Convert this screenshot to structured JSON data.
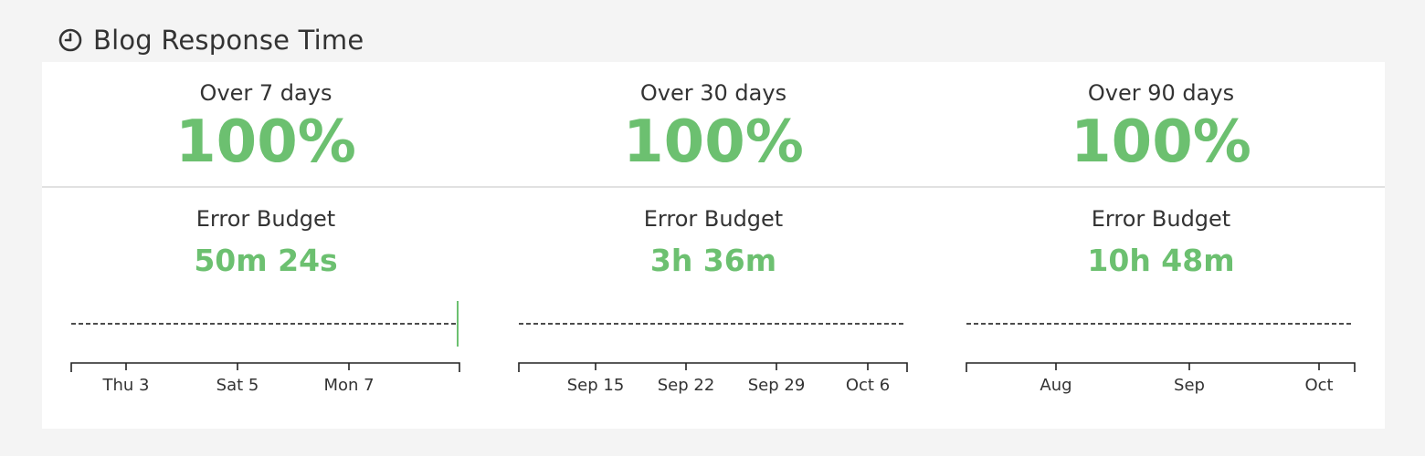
{
  "widget": {
    "title": "Blog Response Time",
    "icon": "clock-icon"
  },
  "colors": {
    "good": "#6cc070",
    "text": "#333333",
    "background": "#f4f4f4",
    "card": "#ffffff"
  },
  "periods": [
    {
      "label": "Over 7 days",
      "percent": "100%",
      "budget_label": "Error Budget",
      "budget_value": "50m 24s",
      "ticks": [
        {
          "label": "Thu 3",
          "pos": 62
        },
        {
          "label": "Sat 5",
          "pos": 184
        },
        {
          "label": "Mon 7",
          "pos": 306
        }
      ],
      "green_bar": true
    },
    {
      "label": "Over 30 days",
      "percent": "100%",
      "budget_label": "Error Budget",
      "budget_value": "3h 36m",
      "ticks": [
        {
          "label": "Sep 15",
          "pos": 86
        },
        {
          "label": "Sep 22",
          "pos": 185
        },
        {
          "label": "Sep 29",
          "pos": 284
        },
        {
          "label": "Oct 6",
          "pos": 384
        }
      ],
      "green_bar": false
    },
    {
      "label": "Over 90 days",
      "percent": "100%",
      "budget_label": "Error Budget",
      "budget_value": "10h 48m",
      "ticks": [
        {
          "label": "Aug",
          "pos": 100
        },
        {
          "label": "Sep",
          "pos": 246
        },
        {
          "label": "Oct",
          "pos": 388
        }
      ],
      "green_bar": false
    }
  ]
}
